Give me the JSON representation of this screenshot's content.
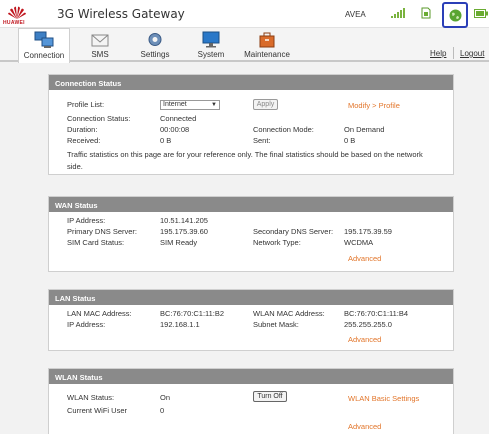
{
  "header": {
    "brand": "HUAWEI",
    "title": "3G Wireless Gateway",
    "operator": "AVEA",
    "icons": {
      "signal": "signal-strength-icon",
      "sim": "sim-card-icon",
      "internet": "globe-icon",
      "battery": "battery-icon"
    }
  },
  "nav": {
    "tabs": [
      {
        "label": "Connection",
        "icon": "computer-icon"
      },
      {
        "label": "SMS",
        "icon": "envelope-icon"
      },
      {
        "label": "Settings",
        "icon": "gear-icon"
      },
      {
        "label": "System",
        "icon": "monitor-icon"
      },
      {
        "label": "Maintenance",
        "icon": "toolbox-icon"
      }
    ],
    "help": "Help",
    "logout": "Logout"
  },
  "connection": {
    "title": "Connection Status",
    "profile_list_label": "Profile List:",
    "profile_value": "Internet",
    "apply": "Apply",
    "modify_link": "Modify > Profile",
    "status_label": "Connection Status:",
    "status_value": "Connected",
    "duration_label": "Duration:",
    "duration_value": "00:00:08",
    "mode_label": "Connection Mode:",
    "mode_value": "On Demand",
    "received_label": "Received:",
    "received_value": "0 B",
    "sent_label": "Sent:",
    "sent_value": "0 B",
    "note_line1": "Traffic statistics on this page are for your reference only. The final statistics should be based on the network",
    "note_line2": "side."
  },
  "wan": {
    "title": "WAN Status",
    "ip_label": "IP Address:",
    "ip_value": "10.51.141.205",
    "dns1_label": "Primary DNS Server:",
    "dns1_value": "195.175.39.60",
    "dns2_label": "Secondary DNS Server:",
    "dns2_value": "195.175.39.59",
    "sim_label": "SIM Card Status:",
    "sim_value": "SIM Ready",
    "net_label": "Network Type:",
    "net_value": "WCDMA",
    "advanced": "Advanced"
  },
  "lan": {
    "title": "LAN Status",
    "mac_label": "LAN MAC Address:",
    "mac_value": "BC:76:70:C1:11:B2",
    "wmac_label": "WLAN MAC Address:",
    "wmac_value": "BC:76:70:C1:11:B4",
    "ip_label": "IP Address:",
    "ip_value": "192.168.1.1",
    "mask_label": "Subnet Mask:",
    "mask_value": "255.255.255.0",
    "advanced": "Advanced"
  },
  "wlan": {
    "title": "WLAN Status",
    "status_label": "WLAN Status:",
    "status_value": "On",
    "turn_off": "Turn Off",
    "basic_link": "WLAN Basic Settings",
    "users_label": "Current WiFi User",
    "users_value": "0",
    "advanced": "Advanced"
  },
  "colors": {
    "accent_link": "#e2752a",
    "panel_header": "#8a8a8a",
    "highlight_box": "#2b3fb7",
    "brand_red": "#c0161e"
  }
}
